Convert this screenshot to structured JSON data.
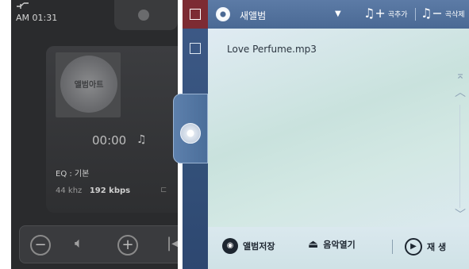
{
  "player": {
    "clock": "AM 01:31",
    "album_art_label": "앨범아트",
    "time": "00:00",
    "eq": "EQ : 기본",
    "sample_rate": "44 khz",
    "bitrate": "192 kbps",
    "icons": [
      "status-icon",
      "music-note-icon",
      "minus-icon",
      "volume-icon",
      "plus-icon",
      "previous-icon"
    ]
  },
  "panel": {
    "album_name": "새앨범",
    "add_song": "곡추가",
    "delete_song": "곡삭제",
    "songs": [
      "Love Perfume.mp3"
    ],
    "footer": {
      "save_album": "앨범저장",
      "open_music": "음악열기",
      "play": "재 생"
    }
  },
  "colors": {
    "header": "#4a6994",
    "select_all_cell": "#7d2b33",
    "list_bg": "#d3e8e4",
    "strip": "#335079",
    "player_bg": "#2a2b2d"
  }
}
